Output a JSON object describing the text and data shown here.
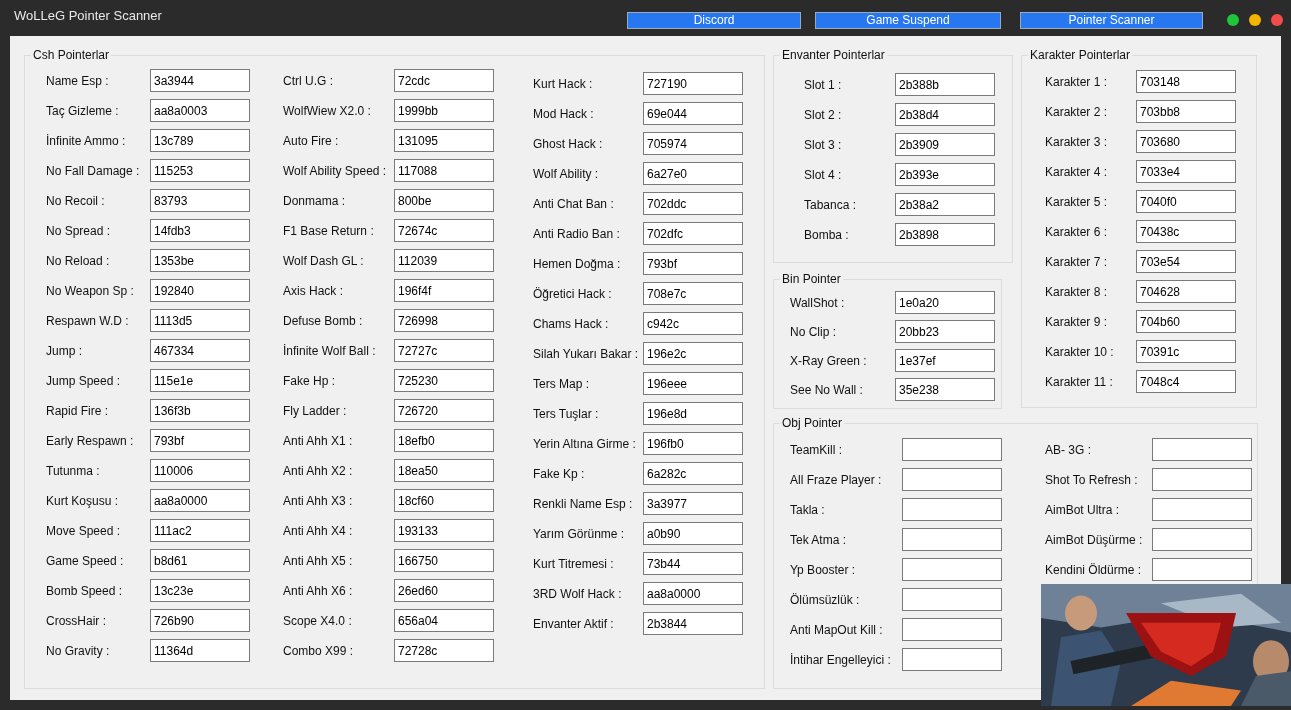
{
  "window": {
    "title": "WoLLeG Pointer Scanner"
  },
  "header_buttons": [
    "Discord",
    "Game Suspend",
    "Pointer Scanner"
  ],
  "groups": [
    {
      "title": "Csh Pointerlar",
      "columns": [
        [
          {
            "label": "Name Esp :",
            "value": "3a3944"
          },
          {
            "label": "Taç Gizleme :",
            "value": "aa8a0003"
          },
          {
            "label": "İnfinite Ammo :",
            "value": "13c789"
          },
          {
            "label": "No Fall Damage :",
            "value": "115253"
          },
          {
            "label": "No Recoil :",
            "value": "83793"
          },
          {
            "label": "No Spread :",
            "value": "14fdb3"
          },
          {
            "label": "No Reload :",
            "value": "1353be"
          },
          {
            "label": "No Weapon Sp :",
            "value": "192840"
          },
          {
            "label": "Respawn W.D :",
            "value": "1113d5"
          },
          {
            "label": "Jump :",
            "value": "467334"
          },
          {
            "label": "Jump Speed :",
            "value": "115e1e"
          },
          {
            "label": "Rapid Fire :",
            "value": "136f3b"
          },
          {
            "label": "Early Respawn :",
            "value": "793bf"
          },
          {
            "label": "Tutunma :",
            "value": "110006"
          },
          {
            "label": "Kurt Koşusu :",
            "value": "aa8a0000"
          },
          {
            "label": "Move Speed :",
            "value": "111ac2"
          },
          {
            "label": "Game Speed :",
            "value": "b8d61"
          },
          {
            "label": "Bomb Speed :",
            "value": "13c23e"
          },
          {
            "label": "CrossHair :",
            "value": "726b90"
          },
          {
            "label": "No Gravity :",
            "value": "11364d"
          }
        ],
        [
          {
            "label": "Ctrl U.G :",
            "value": "72cdc"
          },
          {
            "label": "WolfWiew X2.0 :",
            "value": "1999bb"
          },
          {
            "label": "Auto Fire :",
            "value": "131095"
          },
          {
            "label": "Wolf Ability Speed :",
            "value": "117088"
          },
          {
            "label": "Donmama :",
            "value": "800be"
          },
          {
            "label": "F1 Base Return :",
            "value": "72674c"
          },
          {
            "label": "Wolf Dash GL :",
            "value": "112039"
          },
          {
            "label": "Axis Hack :",
            "value": "196f4f"
          },
          {
            "label": "Defuse Bomb :",
            "value": "726998"
          },
          {
            "label": "İnfinite Wolf Ball :",
            "value": "72727c"
          },
          {
            "label": "Fake Hp :",
            "value": "725230"
          },
          {
            "label": "Fly Ladder :",
            "value": "726720"
          },
          {
            "label": "Anti Ahh X1 :",
            "value": "18efb0"
          },
          {
            "label": "Anti Ahh X2 :",
            "value": "18ea50"
          },
          {
            "label": "Anti Ahh X3 :",
            "value": "18cf60"
          },
          {
            "label": "Anti Ahh X4 :",
            "value": "193133"
          },
          {
            "label": "Anti Ahh X5 :",
            "value": "166750"
          },
          {
            "label": "Anti Ahh X6 :",
            "value": "26ed60"
          },
          {
            "label": "Scope X4.0 :",
            "value": "656a04"
          },
          {
            "label": "Combo X99 :",
            "value": "72728c"
          }
        ],
        [
          {
            "label": "Kurt Hack :",
            "value": "727190"
          },
          {
            "label": "Mod Hack :",
            "value": "69e044"
          },
          {
            "label": "Ghost Hack :",
            "value": "705974"
          },
          {
            "label": "Wolf Ability :",
            "value": "6a27e0"
          },
          {
            "label": "Anti Chat Ban :",
            "value": "702ddc"
          },
          {
            "label": "Anti Radio Ban :",
            "value": "702dfc"
          },
          {
            "label": "Hemen Doğma :",
            "value": "793bf"
          },
          {
            "label": "Öğretici Hack :",
            "value": "708e7c"
          },
          {
            "label": "Chams Hack :",
            "value": "c942c"
          },
          {
            "label": "Silah Yukarı Bakar :",
            "value": "196e2c"
          },
          {
            "label": "Ters Map :",
            "value": "196eee"
          },
          {
            "label": "Ters Tuşlar :",
            "value": "196e8d"
          },
          {
            "label": "Yerin Altına Girme :",
            "value": "196fb0"
          },
          {
            "label": "Fake Kp :",
            "value": "6a282c"
          },
          {
            "label": "Renkli Name Esp :",
            "value": "3a3977"
          },
          {
            "label": "Yarım Görünme :",
            "value": "a0b90"
          },
          {
            "label": "Kurt Titremesi :",
            "value": "73b44"
          },
          {
            "label": "3RD Wolf Hack :",
            "value": "aa8a0000"
          },
          {
            "label": "Envanter Aktif :",
            "value": "2b3844"
          }
        ]
      ]
    },
    {
      "title": "Envanter Pointerlar",
      "columns": [
        [
          {
            "label": "Slot 1 :",
            "value": "2b388b"
          },
          {
            "label": "Slot 2 :",
            "value": "2b38d4"
          },
          {
            "label": "Slot 3 :",
            "value": "2b3909"
          },
          {
            "label": "Slot 4 :",
            "value": "2b393e"
          },
          {
            "label": "Tabanca :",
            "value": "2b38a2"
          },
          {
            "label": "Bomba :",
            "value": "2b3898"
          }
        ]
      ]
    },
    {
      "title": "Bin Pointer",
      "columns": [
        [
          {
            "label": "WallShot :",
            "value": "1e0a20"
          },
          {
            "label": "No Clip :",
            "value": "20bb23"
          },
          {
            "label": "X-Ray Green :",
            "value": "1e37ef"
          },
          {
            "label": "See No Wall :",
            "value": "35e238"
          }
        ]
      ]
    },
    {
      "title": "Karakter Pointerlar",
      "columns": [
        [
          {
            "label": "Karakter 1 :",
            "value": "703148"
          },
          {
            "label": "Karakter 2 :",
            "value": "703bb8"
          },
          {
            "label": "Karakter 3 :",
            "value": "703680"
          },
          {
            "label": "Karakter 4 :",
            "value": "7033e4"
          },
          {
            "label": "Karakter 5 :",
            "value": "7040f0"
          },
          {
            "label": "Karakter 6 :",
            "value": "70438c"
          },
          {
            "label": "Karakter 7 :",
            "value": "703e54"
          },
          {
            "label": "Karakter 8 :",
            "value": "704628"
          },
          {
            "label": "Karakter 9 :",
            "value": "704b60"
          },
          {
            "label": "Karakter 10 :",
            "value": "70391c"
          },
          {
            "label": "Karakter 11 :",
            "value": "7048c4"
          }
        ]
      ]
    },
    {
      "title": "Obj Pointer",
      "columns": [
        [
          {
            "label": "TeamKill :"
          },
          {
            "label": "All Fraze Player :"
          },
          {
            "label": "Takla :"
          },
          {
            "label": "Tek Atma :"
          },
          {
            "label": "Yp Booster :"
          },
          {
            "label": "Ölümsüzlük :"
          },
          {
            "label": "Anti MapOut Kill :"
          },
          {
            "label": "İntihar Engelleyici :"
          }
        ],
        [
          {
            "label": "AB- 3G :"
          },
          {
            "label": "Shot To Refresh :"
          },
          {
            "label": "AimBot Ultra :"
          },
          {
            "label": "AimBot Düşürme :"
          },
          {
            "label": "Kendini Öldürme :"
          }
        ]
      ]
    }
  ],
  "overlay": {
    "kind": "picture"
  }
}
